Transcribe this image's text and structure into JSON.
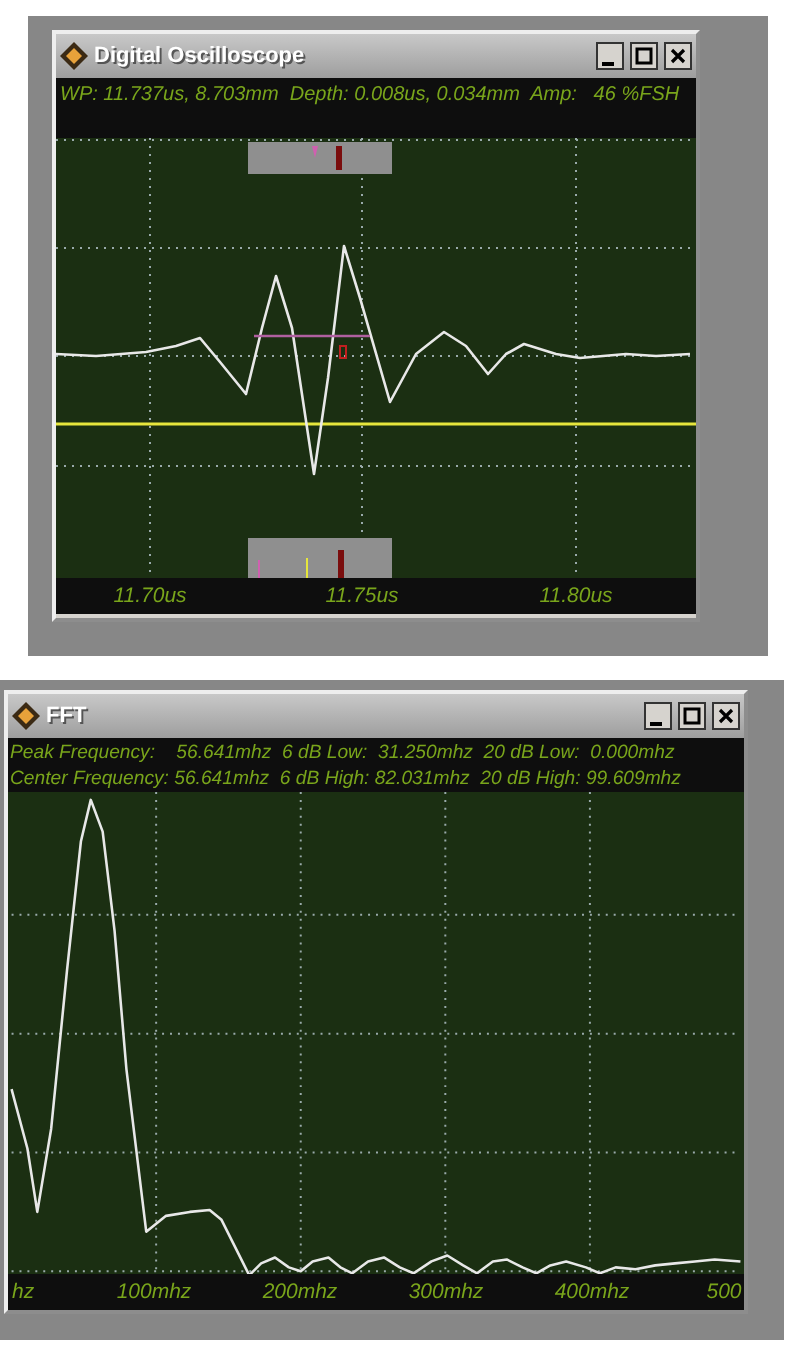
{
  "oscilloscope": {
    "window": {
      "title": "Digital Oscilloscope"
    },
    "info": "WP: 11.737us, 8.703mm  Depth: 0.008us, 0.034mm  Amp:   46 %FSH",
    "x_axis_labels": [
      "11.70us",
      "11.75us",
      "11.80us"
    ]
  },
  "fft": {
    "window": {
      "title": "FFT"
    },
    "info_lines": [
      "Peak Frequency:    56.641mhz  6 dB Low:  31.250mhz  20 dB Low:  0.000mhz",
      "Center Frequency: 56.641mhz  6 dB High: 82.031mhz  20 dB High: 99.609mhz"
    ],
    "x_axis_labels": [
      "hz",
      "100mhz",
      "200mhz",
      "300mhz",
      "400mhz",
      "500"
    ]
  }
}
